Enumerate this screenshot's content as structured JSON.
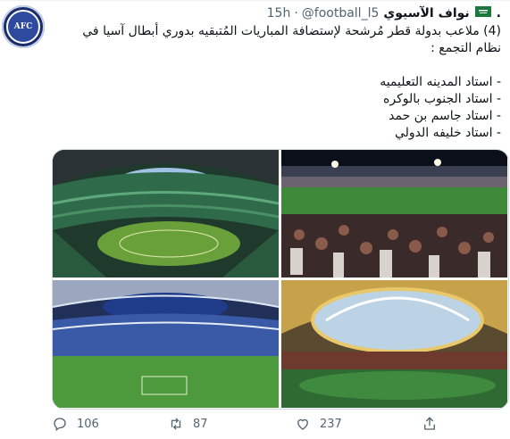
{
  "author": {
    "name": "نواف الآسيوي",
    "handle": "@football_l5",
    "separator": "·",
    "time": "15h",
    "prefix_dot": ".",
    "verified_flag": "saudi-flag-icon",
    "avatar_text": "AFC"
  },
  "tweet": {
    "lines": [
      "(4) ملاعب بدولة قطر مُرشحة لإستضافة المباريات المُتبقيه بدوري أبطال آسيا في",
      "نظام التجمع :"
    ],
    "list": [
      "- استاد المدينه التعليميه",
      "- استاد الجنوب بالوكره",
      "- استاد جاسم بن حمد",
      "- استاد خليفه الدولي"
    ]
  },
  "media": [
    {
      "name": "stadium-photo-1"
    },
    {
      "name": "stadium-photo-2"
    },
    {
      "name": "stadium-photo-3"
    },
    {
      "name": "stadium-photo-4"
    }
  ],
  "actions": {
    "reply_count": "106",
    "retweet_count": "87",
    "like_count": "237",
    "icons": [
      "reply-icon",
      "retweet-icon",
      "like-icon",
      "share-icon"
    ]
  },
  "colors": {
    "text": "#0f1419",
    "muted": "#536471",
    "border": "#cfd9de"
  }
}
